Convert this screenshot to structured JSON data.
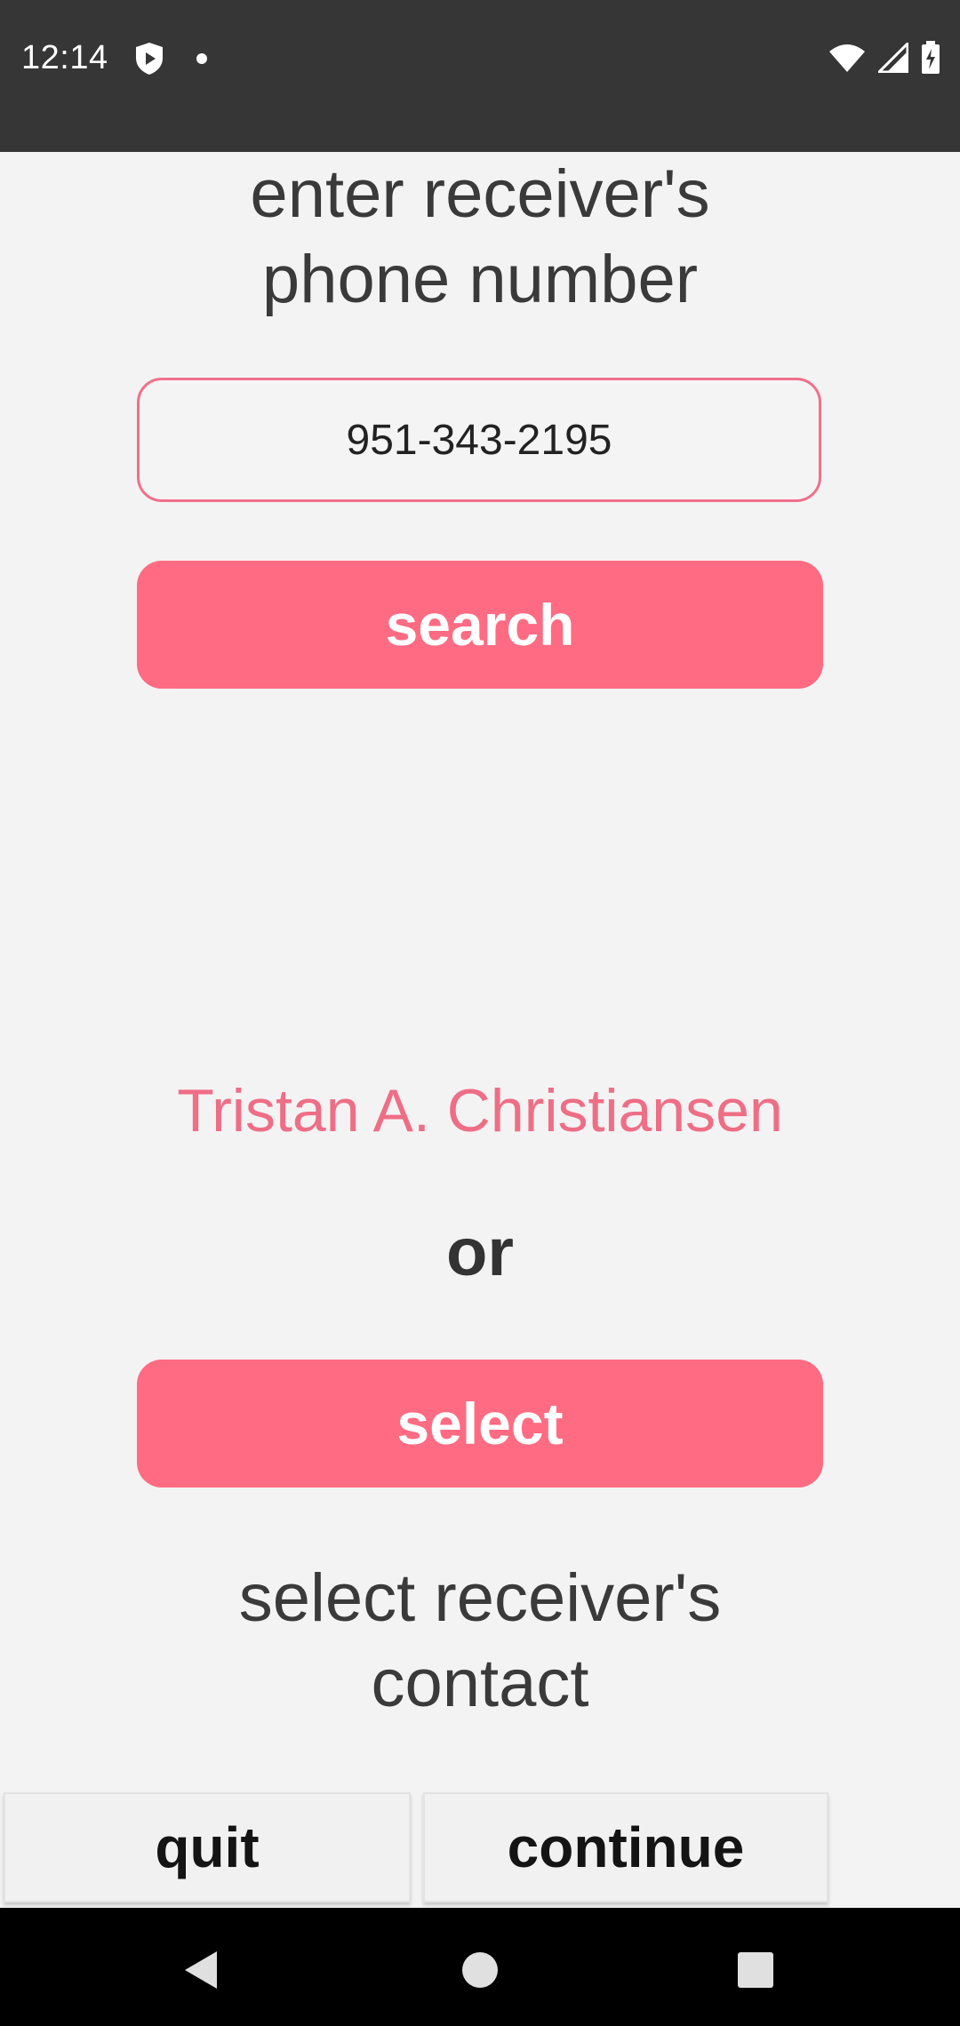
{
  "status_bar": {
    "time": "12:14",
    "left_icons": [
      "shield-play-icon",
      "dot-icon"
    ],
    "right_icons": [
      "wifi-icon",
      "signal-icon",
      "battery-charging-icon"
    ]
  },
  "main": {
    "title_line1": "enter receiver's",
    "title_line2": "phone number",
    "phone_value": "951-343-2195",
    "search_label": "search",
    "found_name": "Tristan A. Christiansen",
    "or_label": "or",
    "select_label": "select",
    "select_hint_line1": "select receiver's",
    "select_hint_line2": "contact"
  },
  "footer": {
    "quit_label": "quit",
    "continue_label": "continue"
  },
  "nav_bar": {
    "icons": [
      "back-icon",
      "home-icon",
      "recents-icon"
    ]
  },
  "colors": {
    "accent": "#ff6b82",
    "accent_text": "#ee6e86",
    "status_bar": "#363636",
    "background": "#f4f3f4"
  }
}
